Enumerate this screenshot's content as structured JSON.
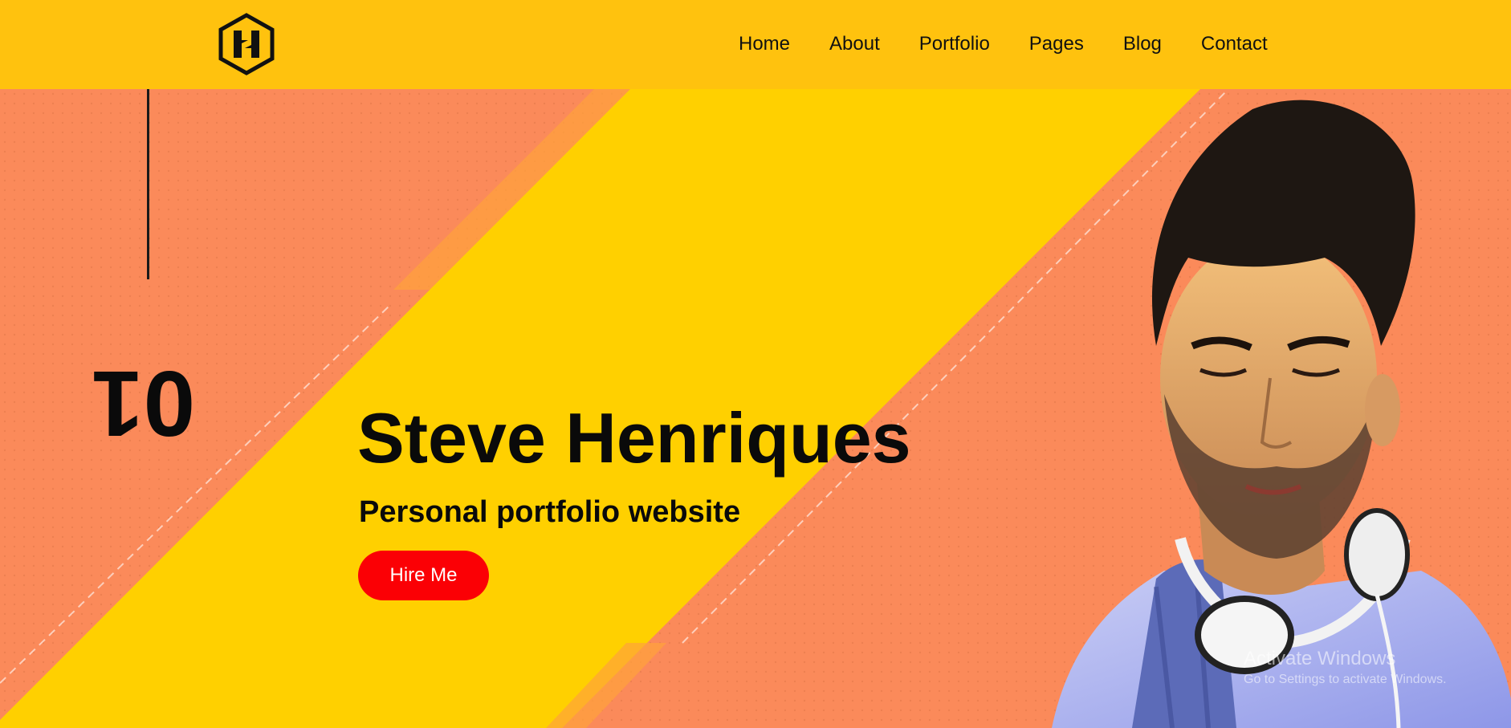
{
  "nav": {
    "logo_letter": "H",
    "items": [
      "Home",
      "About",
      "Portfolio",
      "Pages",
      "Blog",
      "Contact"
    ]
  },
  "hero": {
    "slide_number": "01",
    "title": "Steve Henriques",
    "subtitle": "Personal portfolio website",
    "cta_label": "Hire Me"
  },
  "watermark": {
    "line1": "Activate Windows",
    "line2": "Go to Settings to activate Windows."
  },
  "colors": {
    "nav_bg": "#ffc20e",
    "hero_orange": "#fb8a5a",
    "hero_yellow": "#ffd000",
    "cta": "#fb0005",
    "text": "#0a0a0a"
  }
}
